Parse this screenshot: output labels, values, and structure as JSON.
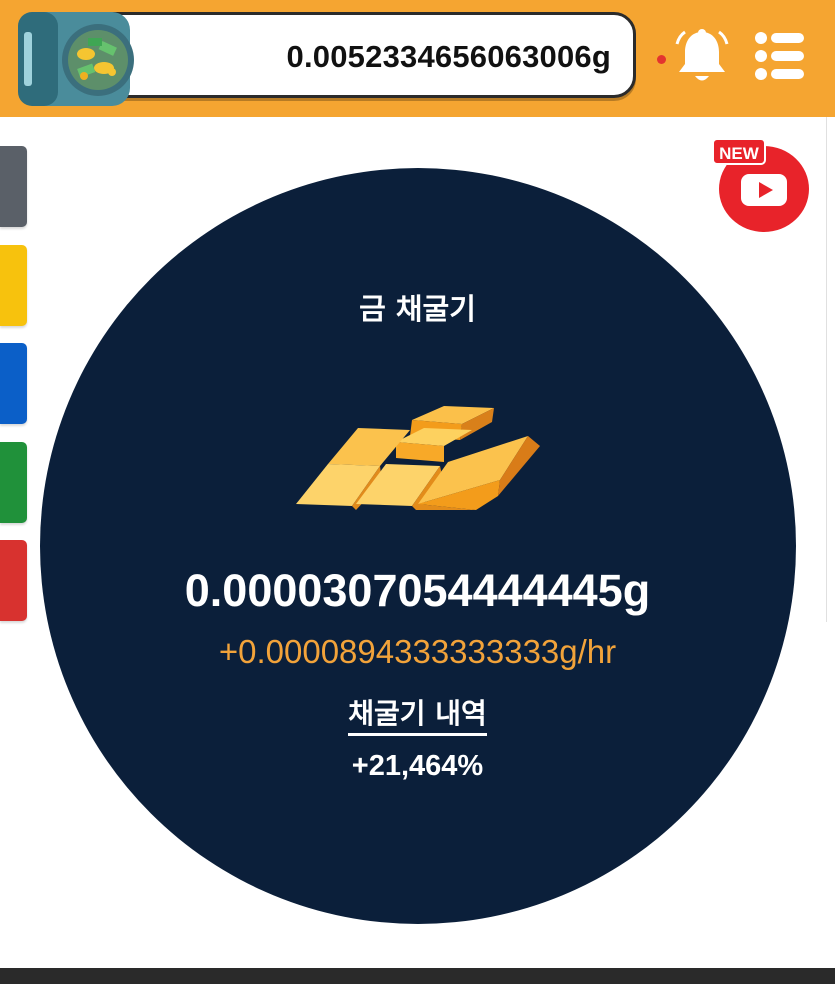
{
  "header": {
    "balance": "0.0052334656063006g",
    "vault_icon": "vault-money-icon",
    "bell_icon": "bell-icon",
    "menu_icon": "menu-list-icon",
    "accent_color": "#f5a531"
  },
  "side_tabs": [
    {
      "name": "side-tab-gray",
      "color": "#5a6068"
    },
    {
      "name": "side-tab-yellow",
      "color": "#f7c20d"
    },
    {
      "name": "side-tab-blue",
      "color": "#0b5fc8"
    },
    {
      "name": "side-tab-green",
      "color": "#20913a"
    },
    {
      "name": "side-tab-red",
      "color": "#d8322f"
    }
  ],
  "youtube": {
    "badge": "NEW",
    "icon": "youtube-play-icon",
    "color": "#e8232a"
  },
  "miner": {
    "title": "금 채굴기",
    "icon": "gold-bars-icon",
    "amount": "0.0000307054444445g",
    "rate": "+0.0000894333333333g/hr",
    "history_label": "채굴기 내역",
    "percent": "+21,464%",
    "circle_color": "#0b1f3a",
    "rate_color": "#f2a33a"
  }
}
